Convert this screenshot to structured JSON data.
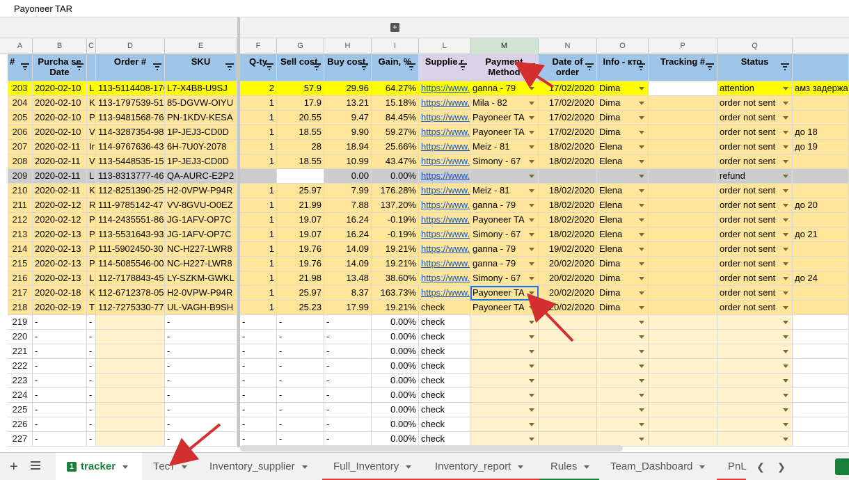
{
  "document": {
    "title": "Payoneer TAR"
  },
  "columns": [
    "A",
    "B",
    "C",
    "D",
    "E",
    "F",
    "G",
    "H",
    "I",
    "L",
    "M",
    "N",
    "O",
    "P",
    "Q"
  ],
  "headers": {
    "num": "#",
    "purchase_date": "Purcha se Date",
    "order": "Order #",
    "sku": "SKU",
    "qty": "Q-ty",
    "sell": "Sell cost,",
    "buy": "Buy cost,",
    "gain": "Gain, %",
    "supplier": "Supplie r",
    "payment": "Payment Method",
    "date_order": "Date of order",
    "info": "Info - кто",
    "tracking": "Tracking #",
    "status": "Status"
  },
  "rows": [
    {
      "n": "203",
      "date": "2020-02-10",
      "c": "L",
      "order": "113-5114408-176",
      "sku": "L7-X4B8-U9SJ",
      "qty": "2",
      "sell": "57.9",
      "buy": "29.96",
      "gain": "64.27%",
      "sup": "https://www.",
      "pay": "ganna - 79",
      "dord": "17/02/2020",
      "info": "Dima",
      "track": "",
      "status": "attention",
      "note": "амз задержа"
    },
    {
      "n": "204",
      "date": "2020-02-10",
      "c": "K",
      "order": "113-1797539-51",
      "sku": "85-DGVW-OIYU",
      "qty": "1",
      "sell": "17.9",
      "buy": "13.21",
      "gain": "15.18%",
      "sup": "https://www.",
      "pay": "Mila - 82",
      "dord": "17/02/2020",
      "info": "Dima",
      "track": "",
      "status": "order not sent",
      "note": ""
    },
    {
      "n": "205",
      "date": "2020-02-10",
      "c": "P",
      "order": "113-9481568-76",
      "sku": "PN-1KDV-KESA",
      "qty": "1",
      "sell": "20.55",
      "buy": "9.47",
      "gain": "84.45%",
      "sup": "https://www.",
      "pay": "Payoneer TA",
      "dord": "17/02/2020",
      "info": "Dima",
      "track": "",
      "status": "order not sent",
      "note": ""
    },
    {
      "n": "206",
      "date": "2020-02-10",
      "c": "V",
      "order": "114-3287354-98",
      "sku": "1P-JEJ3-CD0D",
      "qty": "1",
      "sell": "18.55",
      "buy": "9.90",
      "gain": "59.27%",
      "sup": "https://www.",
      "pay": "Payoneer TA",
      "dord": "17/02/2020",
      "info": "Dima",
      "track": "",
      "status": "order not sent",
      "note": "до 18"
    },
    {
      "n": "207",
      "date": "2020-02-11",
      "c": "Ir",
      "order": "114-9767636-43",
      "sku": "6H-7U0Y-2078",
      "qty": "1",
      "sell": "28",
      "buy": "18.94",
      "gain": "25.66%",
      "sup": "https://www.",
      "pay": "Meiz - 81",
      "dord": "18/02/2020",
      "info": "Elena",
      "track": "",
      "status": "order not sent",
      "note": "до 19"
    },
    {
      "n": "208",
      "date": "2020-02-11",
      "c": "V",
      "order": "113-5448535-15",
      "sku": "1P-JEJ3-CD0D",
      "qty": "1",
      "sell": "18.55",
      "buy": "10.99",
      "gain": "43.47%",
      "sup": "https://www.",
      "pay": "Simony - 67",
      "dord": "18/02/2020",
      "info": "Elena",
      "track": "",
      "status": "order not sent",
      "note": ""
    },
    {
      "n": "209",
      "date": "2020-02-11",
      "c": "L",
      "order": "113-8313777-46",
      "sku": "QA-AURC-E2P2",
      "qty": "",
      "sell": "",
      "buy": "0.00",
      "gain": "0.00%",
      "sup": "https://www.",
      "pay": "",
      "dord": "",
      "info": "",
      "track": "",
      "status": "refund",
      "note": ""
    },
    {
      "n": "210",
      "date": "2020-02-11",
      "c": "K",
      "order": "112-8251390-25",
      "sku": "H2-0VPW-P94R",
      "qty": "1",
      "sell": "25.97",
      "buy": "7.99",
      "gain": "176.28%",
      "sup": "https://www.",
      "pay": "Meiz - 81",
      "dord": "18/02/2020",
      "info": "Elena",
      "track": "",
      "status": "order not sent",
      "note": ""
    },
    {
      "n": "211",
      "date": "2020-02-12",
      "c": "R",
      "order": "111-9785142-47",
      "sku": "VV-8GVU-O0EZ",
      "qty": "1",
      "sell": "21.99",
      "buy": "7.88",
      "gain": "137.20%",
      "sup": "https://www.",
      "pay": "ganna - 79",
      "dord": "18/02/2020",
      "info": "Elena",
      "track": "",
      "status": "order not sent",
      "note": "до 20"
    },
    {
      "n": "212",
      "date": "2020-02-12",
      "c": "P",
      "order": "114-2435551-86",
      "sku": "JG-1AFV-OP7C",
      "qty": "1",
      "sell": "19.07",
      "buy": "16.24",
      "gain": "-0.19%",
      "sup": "https://www.",
      "pay": "Payoneer TA",
      "dord": "18/02/2020",
      "info": "Elena",
      "track": "",
      "status": "order not sent",
      "note": ""
    },
    {
      "n": "213",
      "date": "2020-02-13",
      "c": "P",
      "order": "113-5531643-93",
      "sku": "JG-1AFV-OP7C",
      "qty": "1",
      "sell": "19.07",
      "buy": "16.24",
      "gain": "-0.19%",
      "sup": "https://www.",
      "pay": "Simony - 67",
      "dord": "18/02/2020",
      "info": "Elena",
      "track": "",
      "status": "order not sent",
      "note": "до 21"
    },
    {
      "n": "214",
      "date": "2020-02-13",
      "c": "P",
      "order": "111-5902450-30",
      "sku": "NC-H227-LWR8",
      "qty": "1",
      "sell": "19.76",
      "buy": "14.09",
      "gain": "19.21%",
      "sup": "https://www.",
      "pay": "ganna - 79",
      "dord": "19/02/2020",
      "info": "Elena",
      "track": "",
      "status": "order not sent",
      "note": ""
    },
    {
      "n": "215",
      "date": "2020-02-13",
      "c": "P",
      "order": "114-5085546-00",
      "sku": "NC-H227-LWR8",
      "qty": "1",
      "sell": "19.76",
      "buy": "14.09",
      "gain": "19.21%",
      "sup": "https://www.",
      "pay": "ganna - 79",
      "dord": "20/02/2020",
      "info": "Dima",
      "track": "",
      "status": "order not sent",
      "note": ""
    },
    {
      "n": "216",
      "date": "2020-02-13",
      "c": "L",
      "order": "112-7178843-45",
      "sku": "LY-SZKM-GWKL",
      "qty": "1",
      "sell": "21.98",
      "buy": "13.48",
      "gain": "38.60%",
      "sup": "https://www.",
      "pay": "Simony - 67",
      "dord": "20/02/2020",
      "info": "Dima",
      "track": "",
      "status": "order not sent",
      "note": "до 24"
    },
    {
      "n": "217",
      "date": "2020-02-18",
      "c": "K",
      "order": "112-6712378-05",
      "sku": "H2-0VPW-P94R",
      "qty": "1",
      "sell": "25.97",
      "buy": "8.37",
      "gain": "163.73%",
      "sup": "https://www.",
      "pay": "Payoneer TA",
      "dord": "20/02/2020",
      "info": "Dima",
      "track": "",
      "status": "order not sent",
      "note": ""
    },
    {
      "n": "218",
      "date": "2020-02-19",
      "c": "T",
      "order": "112-7275330-77",
      "sku": "UL-VAGH-B9SH",
      "qty": "1",
      "sell": "25.23",
      "buy": "17.99",
      "gain": "19.21%",
      "sup": "check",
      "pay": "Payoneer TA",
      "dord": "20/02/2020",
      "info": "Dima",
      "track": "",
      "status": "order not sent",
      "note": ""
    }
  ],
  "empty_rows": [
    "219",
    "220",
    "221",
    "222",
    "223",
    "224",
    "225",
    "226",
    "227"
  ],
  "empty_row_values": {
    "dash": "-",
    "gain": "0.00%",
    "sup": "check"
  },
  "tabs": [
    {
      "label": "tracker",
      "badge": "1",
      "active": true,
      "underline": ""
    },
    {
      "label": "Тест",
      "badge": "",
      "active": false,
      "underline": ""
    },
    {
      "label": "Inventory_supplier",
      "badge": "",
      "active": false,
      "underline": ""
    },
    {
      "label": "Full_Inventory",
      "badge": "",
      "active": false,
      "underline": "#e53935"
    },
    {
      "label": "Inventory_report",
      "badge": "",
      "active": false,
      "underline": "#e53935"
    },
    {
      "label": "Rules",
      "badge": "",
      "active": false,
      "underline": "#188038"
    },
    {
      "label": "Team_Dashboard",
      "badge": "",
      "active": false,
      "underline": ""
    },
    {
      "label": "PnL",
      "badge": "",
      "active": false,
      "underline": "#e53935"
    }
  ],
  "colors": {
    "header_blue": "#9fc5e8",
    "header_purple": "#d9d2e9",
    "row_orange": "#ffe599",
    "row_yellow": "#ffff00",
    "row_gray": "#cccccc",
    "arrow_red": "#d32f2f",
    "tab_green": "#188038"
  },
  "icons": {
    "add_sheet": "plus-icon",
    "all_sheets": "menu-icon",
    "filter": "filter-icon",
    "dropdown": "chevron-down-icon",
    "group": "plus-box-icon"
  }
}
